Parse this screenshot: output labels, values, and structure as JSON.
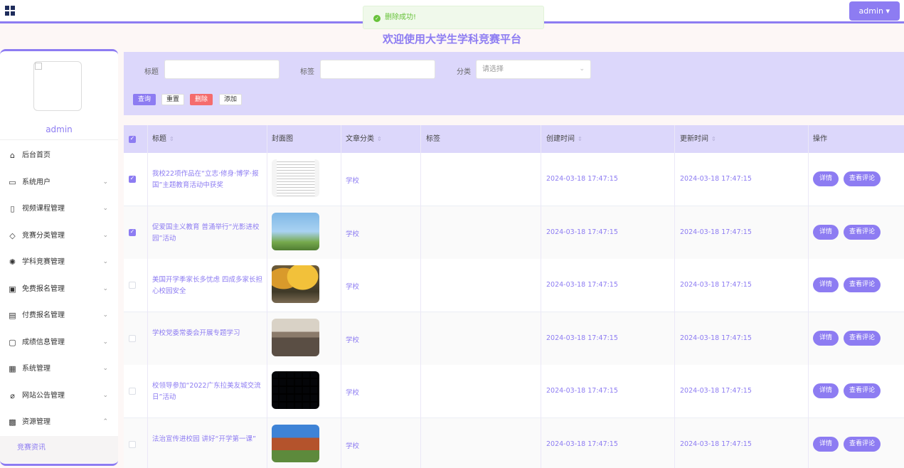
{
  "topbar": {
    "user_label": "admin",
    "user_caret": "▾"
  },
  "toast": {
    "message": "删除成功!"
  },
  "page_title": "欢迎使用大学生学科竞赛平台",
  "sidebar": {
    "username": "admin",
    "menu": [
      {
        "label": "后台首页",
        "icon": "home-icon",
        "glyph": "⌂",
        "expandable": false
      },
      {
        "label": "系统用户",
        "icon": "monitor-icon",
        "glyph": "▭",
        "expandable": true
      },
      {
        "label": "视频课程管理",
        "icon": "bookmark-icon",
        "glyph": "▯",
        "expandable": true
      },
      {
        "label": "竞赛分类管理",
        "icon": "tag-icon",
        "glyph": "◇",
        "expandable": true
      },
      {
        "label": "学科竞赛管理",
        "icon": "sun-icon",
        "glyph": "✺",
        "expandable": true
      },
      {
        "label": "免费报名管理",
        "icon": "inbox-icon",
        "glyph": "▣",
        "expandable": true
      },
      {
        "label": "付费报名管理",
        "icon": "clipboard-icon",
        "glyph": "▤",
        "expandable": true
      },
      {
        "label": "成绩信息管理",
        "icon": "chat-icon",
        "glyph": "▢",
        "expandable": true
      },
      {
        "label": "系统管理",
        "icon": "archive-icon",
        "glyph": "▦",
        "expandable": true
      },
      {
        "label": "网站公告管理",
        "icon": "paperclip-icon",
        "glyph": "⌀",
        "expandable": true
      },
      {
        "label": "资源管理",
        "icon": "copy-icon",
        "glyph": "▩",
        "expandable": true,
        "expanded": true
      }
    ],
    "submenu": [
      {
        "label": "竞赛资讯"
      }
    ],
    "chevron_down": "⌄",
    "chevron_up": "⌃"
  },
  "search": {
    "title_label": "标题",
    "tag_label": "标签",
    "category_label": "分类",
    "category_placeholder": "请选择",
    "buttons": {
      "query": "查询",
      "reset": "重置",
      "delete": "删除",
      "add": "添加"
    }
  },
  "table": {
    "columns": [
      "标题",
      "封面图",
      "文章分类",
      "标签",
      "创建时间",
      "更新时间",
      "操作"
    ],
    "sort_glyph": "⇕",
    "action_labels": {
      "detail": "详情",
      "comments": "查看评论"
    },
    "rows": [
      {
        "title": "我校22项作品在“立志·修身·博学·报国”主题教育活动中获奖",
        "category": "学校",
        "tag": "",
        "created": "2024-03-18 17:47:15",
        "updated": "2024-03-18 17:47:15",
        "checked": true,
        "thumb": "document"
      },
      {
        "title": "促爱国主义教育 普涌举行“光影进校园”活动",
        "category": "学校",
        "tag": "",
        "created": "2024-03-18 17:47:15",
        "updated": "2024-03-18 17:47:15",
        "checked": true,
        "thumb": "building-sky"
      },
      {
        "title": "美国开学季家长多忧虑 四成多家长担心校园安全",
        "category": "学校",
        "tag": "",
        "created": "2024-03-18 17:47:15",
        "updated": "2024-03-18 17:47:15",
        "checked": false,
        "thumb": "autumn"
      },
      {
        "title": "学校党委常委会开展专题学习",
        "category": "学校",
        "tag": "",
        "created": "2024-03-18 17:47:15",
        "updated": "2024-03-18 17:47:15",
        "checked": false,
        "thumb": "meeting"
      },
      {
        "title": "校领导参加“2022广东拉美友城交流日”活动",
        "category": "学校",
        "tag": "",
        "created": "2024-03-18 17:47:15",
        "updated": "2024-03-18 17:47:15",
        "checked": false,
        "thumb": "video-wall"
      },
      {
        "title": "法治宣传进校园 讲好“开学第一课”",
        "category": "学校",
        "tag": "",
        "created": "2024-03-18 17:47:15",
        "updated": "2024-03-18 17:47:15",
        "checked": false,
        "thumb": "campus"
      }
    ]
  },
  "colors": {
    "accent": "#8d7cf2",
    "header_bg": "#dcd7fb",
    "danger": "#f56c6c",
    "success": "#67c23a"
  }
}
